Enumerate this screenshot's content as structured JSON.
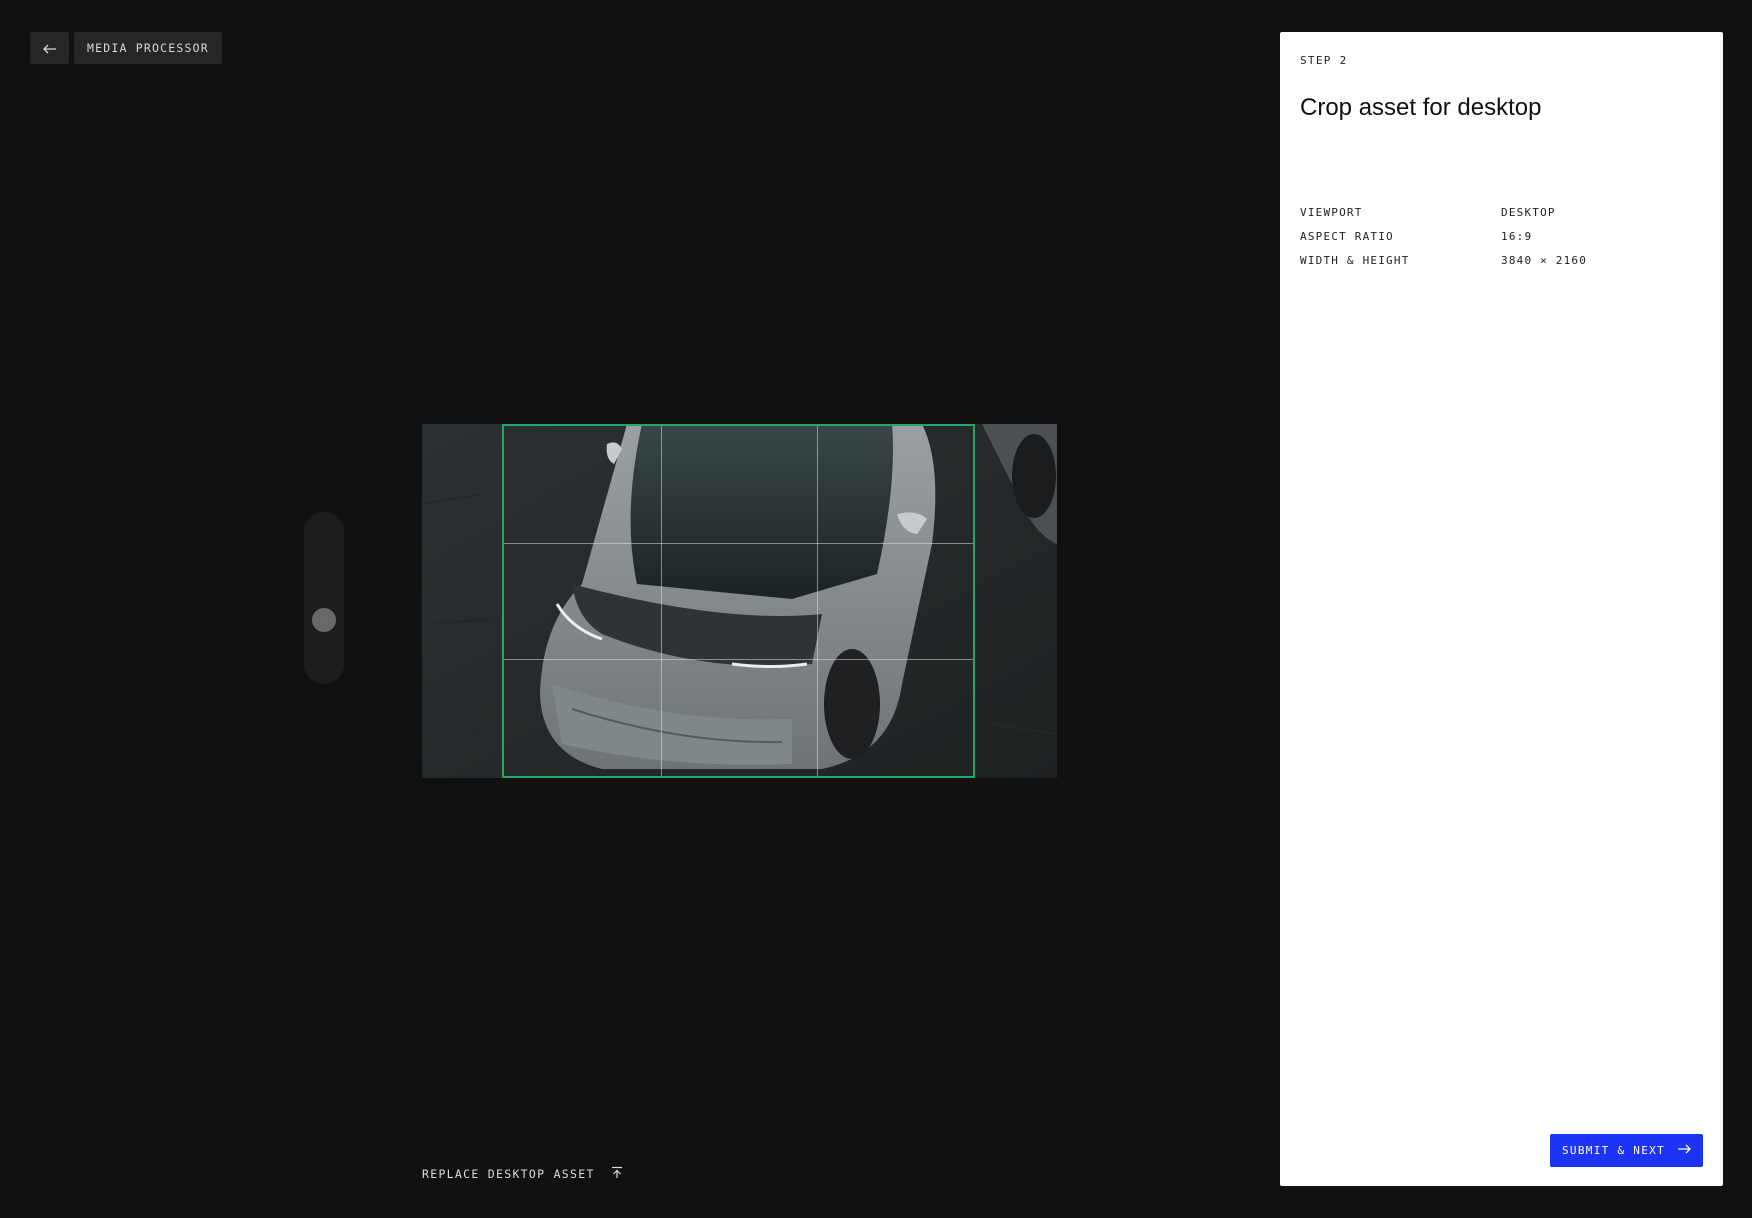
{
  "nav": {
    "back_icon": "arrow-left-icon",
    "app_title": "MEDIA PROCESSOR"
  },
  "editor": {
    "zoom_level": 0.33,
    "replace_label": "REPLACE DESKTOP ASSET",
    "replace_icon": "upload-icon",
    "crop_color": "#1fa868"
  },
  "panel": {
    "step": "STEP 2",
    "title": "Crop asset for desktop",
    "specs": [
      {
        "key": "VIEWPORT",
        "value": "DESKTOP"
      },
      {
        "key": "ASPECT RATIO",
        "value": "16:9"
      },
      {
        "key": "WIDTH & HEIGHT",
        "value": "3840 × 2160"
      }
    ],
    "submit_label": "SUBMIT & NEXT",
    "submit_icon": "arrow-right-icon",
    "accent_color": "#1d34f5"
  }
}
